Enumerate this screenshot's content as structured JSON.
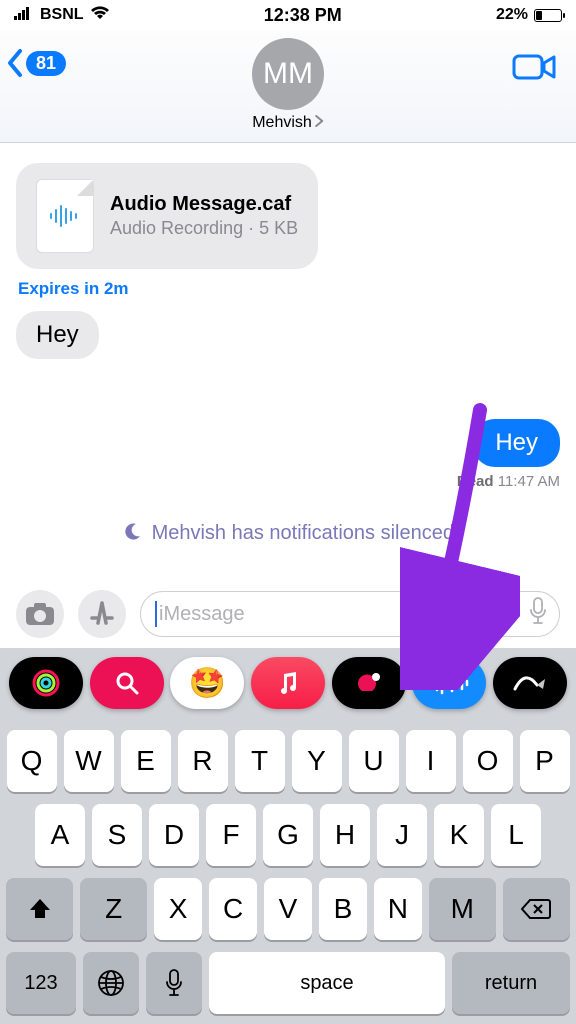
{
  "status": {
    "carrier": "BSNL",
    "time": "12:38 PM",
    "battery_pct": "22%"
  },
  "header": {
    "back_count": "81",
    "avatar_initials": "MM",
    "contact": "Mehvish"
  },
  "messages": {
    "attachment": {
      "title": "Audio Message.caf",
      "subtitle": "Audio Recording · 5 KB"
    },
    "expires": "Expires in 2m",
    "incoming_1": "Hey",
    "outgoing_1": "Hey",
    "read_label": "Read",
    "read_time": "11:47 AM",
    "silenced": "Mehvish has notifications silenced"
  },
  "compose": {
    "placeholder": "iMessage"
  },
  "keyboard": {
    "row1": [
      "Q",
      "W",
      "E",
      "R",
      "T",
      "Y",
      "U",
      "I",
      "O",
      "P"
    ],
    "row2": [
      "A",
      "S",
      "D",
      "F",
      "G",
      "H",
      "J",
      "K",
      "L"
    ],
    "row3": [
      "Z",
      "X",
      "C",
      "V",
      "B",
      "N",
      "M"
    ],
    "num": "123",
    "space": "space",
    "return": "return"
  },
  "colors": {
    "blue": "#0a7aff",
    "grey_bubble": "#e9e9eb",
    "arrow": "#8a2be2"
  }
}
